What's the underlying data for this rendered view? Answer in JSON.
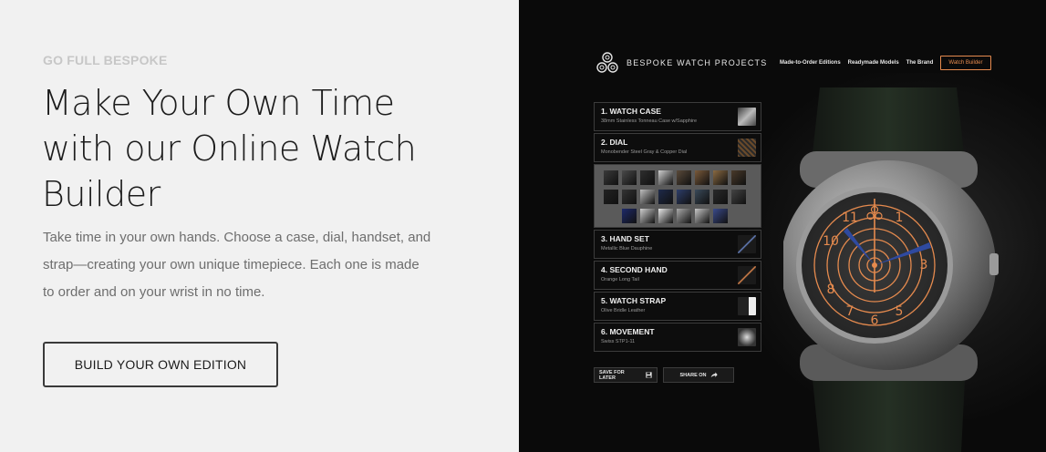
{
  "hero": {
    "eyebrow": "GO FULL BESPOKE",
    "headline_lines": [
      "Make Your Own Time",
      "with our Online Watch",
      "Builder"
    ],
    "description_lines": [
      "Take time in your own hands. Choose a case, dial, handset, and",
      "strap—creating your own unique timepiece. Each one is made",
      "to order and on your wrist in no time."
    ],
    "cta_label": "BUILD YOUR OWN EDITION"
  },
  "builder": {
    "brand_name": "BESPOKE WATCH PROJECTS",
    "nav": {
      "items": [
        "Made-to-Order Editions",
        "Readymade Models",
        "The Brand"
      ],
      "button_label": "Watch Builder"
    },
    "steps": [
      {
        "title": "1. WATCH CASE",
        "subtitle": "38mm Stainless Tonneau Case w/Sapphire"
      },
      {
        "title": "2. DIAL",
        "subtitle": "Monobender Steel Gray & Copper Dial"
      },
      {
        "title": "3. HAND SET",
        "subtitle": "Metallic Blue Dauphine"
      },
      {
        "title": "4. SECOND HAND",
        "subtitle": "Orange Long Tail"
      },
      {
        "title": "5. WATCH STRAP",
        "subtitle": "Olive Bridle Leather"
      },
      {
        "title": "6. MOVEMENT",
        "subtitle": "Swiss STP1-11"
      }
    ],
    "actions": {
      "save_label": "SAVE FOR LATER",
      "share_label": "SHARE ON"
    },
    "dial_numerals": [
      "1",
      "3",
      "5",
      "6",
      "7",
      "8",
      "10",
      "11"
    ],
    "colors": {
      "accent": "#e58a4e",
      "hands": "#2f4aa0",
      "panel_bg": "#0a0a0a"
    }
  }
}
